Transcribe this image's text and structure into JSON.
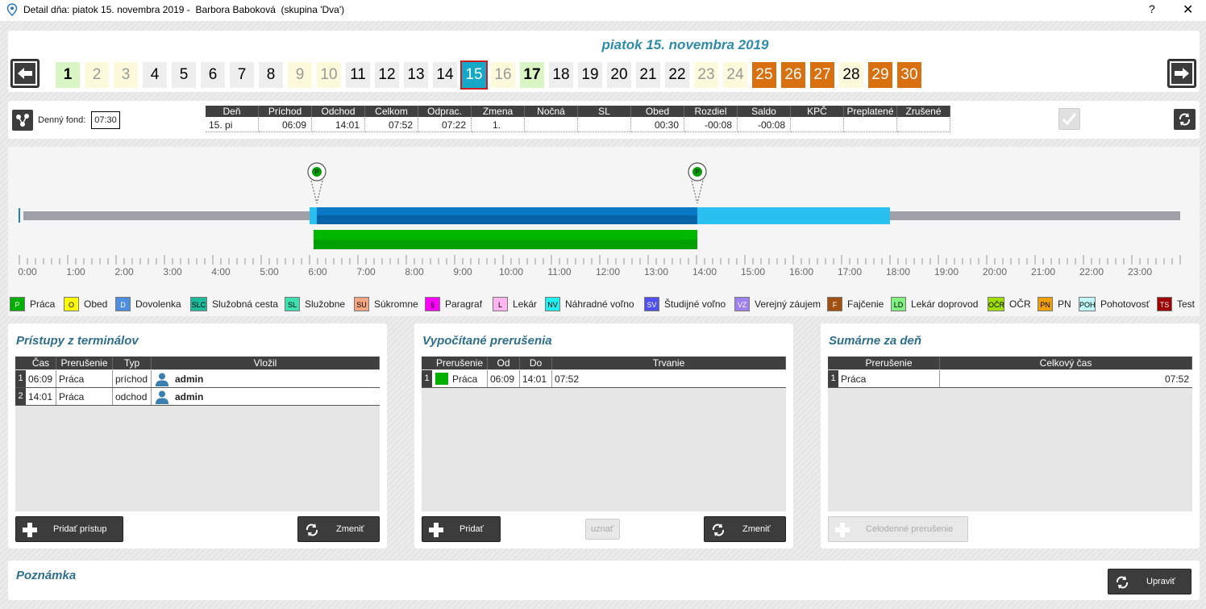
{
  "window": {
    "title": "Detail dňa: piatok 15. novembra 2019 -  Barbora Baboková  (skupina 'Dva')",
    "help": "?",
    "close": "✕"
  },
  "header": {
    "date": "piatok 15. novembra 2019",
    "days": [
      {
        "n": "1",
        "style": "green",
        "bold": true
      },
      {
        "n": "2",
        "style": "yellow"
      },
      {
        "n": "3",
        "style": "yellow"
      },
      {
        "n": "4",
        "style": "gray"
      },
      {
        "n": "5",
        "style": "gray"
      },
      {
        "n": "6",
        "style": "gray"
      },
      {
        "n": "7",
        "style": "gray"
      },
      {
        "n": "8",
        "style": "gray"
      },
      {
        "n": "9",
        "style": "yellow"
      },
      {
        "n": "10",
        "style": "yellow"
      },
      {
        "n": "11",
        "style": "gray"
      },
      {
        "n": "12",
        "style": "gray"
      },
      {
        "n": "13",
        "style": "gray"
      },
      {
        "n": "14",
        "style": "gray"
      },
      {
        "n": "15",
        "style": "sel"
      },
      {
        "n": "16",
        "style": "yellow"
      },
      {
        "n": "17",
        "style": "green",
        "bold": true
      },
      {
        "n": "18",
        "style": "gray"
      },
      {
        "n": "19",
        "style": "gray"
      },
      {
        "n": "20",
        "style": "gray"
      },
      {
        "n": "21",
        "style": "gray"
      },
      {
        "n": "22",
        "style": "gray"
      },
      {
        "n": "23",
        "style": "yellow"
      },
      {
        "n": "24",
        "style": "yellow"
      },
      {
        "n": "25",
        "style": "orange"
      },
      {
        "n": "26",
        "style": "orange"
      },
      {
        "n": "27",
        "style": "orange"
      },
      {
        "n": "28",
        "style": "ltyellow"
      },
      {
        "n": "29",
        "style": "orange"
      },
      {
        "n": "30",
        "style": "orange"
      }
    ]
  },
  "info": {
    "fund_label": "Denný fond:",
    "fund_value": "07:30",
    "columns": [
      "Deň",
      "Príchod",
      "Odchod",
      "Celkom",
      "Odprac.",
      "Zmena",
      "Nočná",
      "SL",
      "Obed",
      "Rozdiel",
      "Saldo",
      "KPČ",
      "Preplatené",
      "Zrušené"
    ],
    "row": [
      "15. pi",
      "06:09",
      "14:01",
      "07:52",
      "07:22",
      "1.",
      "",
      "",
      "00:30",
      "-00:08",
      "-00:08",
      "",
      "",
      ""
    ]
  },
  "timeline": {
    "hours": [
      "0:00",
      "1:00",
      "2:00",
      "3:00",
      "4:00",
      "5:00",
      "6:00",
      "7:00",
      "8:00",
      "9:00",
      "10:00",
      "11:00",
      "12:00",
      "13:00",
      "14:00",
      "15:00",
      "16:00",
      "17:00",
      "18:00",
      "19:00",
      "20:00",
      "21:00",
      "22:00",
      "23:00"
    ],
    "marker_letter": "P",
    "markers_at": [
      "06:09",
      "14:01"
    ],
    "shift": {
      "from": "06:00",
      "to": "18:00"
    },
    "worked": {
      "from": "06:09",
      "to": "14:01"
    },
    "break_bar": {
      "from": "06:05",
      "to": "14:01",
      "color": "#00b800"
    }
  },
  "legend": [
    {
      "code": "P",
      "label": "Práca",
      "color": "#00b000",
      "fg": "#fff"
    },
    {
      "code": "O",
      "label": "Obed",
      "color": "#ffff00",
      "fg": "#000"
    },
    {
      "code": "D",
      "label": "Dovolenka",
      "color": "#4f8fe0",
      "fg": "#fff"
    },
    {
      "code": "SLC",
      "label": "Služobná cesta",
      "color": "#1abc9c",
      "fg": "#000"
    },
    {
      "code": "SL",
      "label": "Služobne",
      "color": "#3fe0b0",
      "fg": "#000"
    },
    {
      "code": "SU",
      "label": "Súkromne",
      "color": "#f4a582",
      "fg": "#000"
    },
    {
      "code": "§",
      "label": "Paragraf",
      "color": "#ff00ff",
      "fg": "#000"
    },
    {
      "code": "L",
      "label": "Lekár",
      "color": "#ffb6f0",
      "fg": "#000"
    },
    {
      "code": "NV",
      "label": "Náhradné voľno",
      "color": "#20f0f0",
      "fg": "#000"
    },
    {
      "code": "SV",
      "label": "Študijné voľno",
      "color": "#5050f0",
      "fg": "#fff"
    },
    {
      "code": "VZ",
      "label": "Verejný záujem",
      "color": "#a080f0",
      "fg": "#fff"
    },
    {
      "code": "F",
      "label": "Fajčenie",
      "color": "#a05010",
      "fg": "#fff"
    },
    {
      "code": "LD",
      "label": "Lekár doprovod",
      "color": "#80f080",
      "fg": "#000"
    },
    {
      "code": "OČR",
      "label": "OČR",
      "color": "#a0e000",
      "fg": "#000"
    },
    {
      "code": "PN",
      "label": "PN",
      "color": "#f0a000",
      "fg": "#000"
    },
    {
      "code": "POH",
      "label": "Pohotovosť",
      "color": "#c0f8f8",
      "fg": "#000"
    },
    {
      "code": "TS",
      "label": "Test",
      "color": "#a00000",
      "fg": "#fff"
    }
  ],
  "access": {
    "title": "Prístupy z terminálov",
    "columns": [
      "Čas",
      "Prerušenie",
      "Typ",
      "Vložil"
    ],
    "rows": [
      {
        "n": "1",
        "time": "06:09",
        "type": "Práca",
        "dir": "príchod",
        "by": "admin"
      },
      {
        "n": "2",
        "time": "14:01",
        "type": "Práca",
        "dir": "odchod",
        "by": "admin"
      }
    ],
    "add_label": "Pridať prístup",
    "change_label": "Zmeniť"
  },
  "computed": {
    "title": "Vypočítané prerušenia",
    "columns": [
      "Prerušenie",
      "Od",
      "Do",
      "Trvanie"
    ],
    "rows": [
      {
        "n": "1",
        "type": "Práca",
        "color": "#00b000",
        "from": "06:09",
        "to": "14:01",
        "duration": "07:52"
      }
    ],
    "add_label": "Pridať",
    "accept_label": "uznať",
    "change_label": "Zmeniť"
  },
  "summary": {
    "title": "Sumárne za deň",
    "columns": [
      "Prerušenie",
      "Celkový čas"
    ],
    "rows": [
      {
        "n": "1",
        "type": "Práca",
        "total": "07:52"
      }
    ],
    "allday_label": "Celodenné prerušenie"
  },
  "note": {
    "title": "Poznámka",
    "edit_label": "Upraviť"
  }
}
